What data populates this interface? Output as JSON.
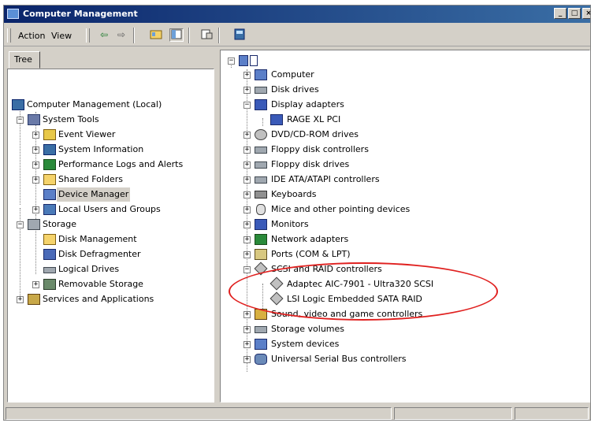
{
  "window": {
    "title": "Computer Management"
  },
  "menubar": {
    "action_label": "Action",
    "view_label": "View"
  },
  "tabs": [
    {
      "label": "Tree"
    }
  ],
  "tree": {
    "items": [
      {
        "label": "Computer Management (Local)",
        "icon": "computer-management-icon"
      },
      {
        "label": "System Tools",
        "icon": "tools-icon"
      },
      {
        "label": "Event Viewer",
        "icon": "event-viewer-icon"
      },
      {
        "label": "System Information",
        "icon": "system-info-icon"
      },
      {
        "label": "Performance Logs and Alerts",
        "icon": "performance-icon"
      },
      {
        "label": "Shared Folders",
        "icon": "shared-folder-icon"
      },
      {
        "label": "Device Manager",
        "icon": "device-manager-icon",
        "selected": true
      },
      {
        "label": "Local Users and Groups",
        "icon": "users-icon"
      },
      {
        "label": "Storage",
        "icon": "storage-icon"
      },
      {
        "label": "Disk Management",
        "icon": "disk-management-icon"
      },
      {
        "label": "Disk Defragmenter",
        "icon": "defragmenter-icon"
      },
      {
        "label": "Logical Drives",
        "icon": "logical-drives-icon"
      },
      {
        "label": "Removable Storage",
        "icon": "removable-storage-icon"
      },
      {
        "label": "Services and Applications",
        "icon": "services-icon"
      }
    ]
  },
  "devices": {
    "items": [
      {
        "label": "Computer",
        "icon": "computer-icon"
      },
      {
        "label": "Disk drives",
        "icon": "disk-drive-icon"
      },
      {
        "label": "Display adapters",
        "icon": "display-adapter-icon"
      },
      {
        "label": "RAGE XL  PCI",
        "icon": "display-adapter-icon"
      },
      {
        "label": "DVD/CD-ROM drives",
        "icon": "cdrom-icon"
      },
      {
        "label": "Floppy disk controllers",
        "icon": "controller-icon"
      },
      {
        "label": "Floppy disk drives",
        "icon": "floppy-drive-icon"
      },
      {
        "label": "IDE ATA/ATAPI controllers",
        "icon": "ide-controller-icon"
      },
      {
        "label": "Keyboards",
        "icon": "keyboard-icon"
      },
      {
        "label": "Mice and other pointing devices",
        "icon": "mouse-icon"
      },
      {
        "label": "Monitors",
        "icon": "monitor-icon"
      },
      {
        "label": "Network adapters",
        "icon": "network-adapter-icon"
      },
      {
        "label": "Ports (COM & LPT)",
        "icon": "port-icon"
      },
      {
        "label": "SCSI and RAID controllers",
        "icon": "scsi-icon"
      },
      {
        "label": "Adaptec AIC-7901 - Ultra320 SCSI",
        "icon": "scsi-icon"
      },
      {
        "label": "LSI Logic Embedded SATA RAID",
        "icon": "scsi-icon"
      },
      {
        "label": "Sound, video and game controllers",
        "icon": "sound-icon"
      },
      {
        "label": "Storage volumes",
        "icon": "storage-volume-icon"
      },
      {
        "label": "System devices",
        "icon": "system-devices-icon"
      },
      {
        "label": "Universal Serial Bus controllers",
        "icon": "usb-icon"
      }
    ]
  },
  "colors": {
    "titlebar": "#0a246a",
    "annotation": "#e0201f",
    "chrome": "#d4d0c8"
  }
}
